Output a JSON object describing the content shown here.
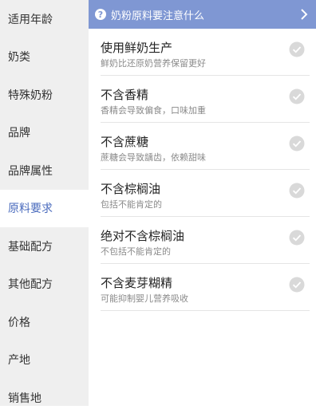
{
  "sidebar": {
    "items": [
      {
        "label": "适用年龄",
        "active": false
      },
      {
        "label": "奶类",
        "active": false
      },
      {
        "label": "特殊奶粉",
        "active": false
      },
      {
        "label": "品牌",
        "active": false
      },
      {
        "label": "品牌属性",
        "active": false
      },
      {
        "label": "原料要求",
        "active": true
      },
      {
        "label": "基础配方",
        "active": false
      },
      {
        "label": "其他配方",
        "active": false
      },
      {
        "label": "价格",
        "active": false
      },
      {
        "label": "产地",
        "active": false
      },
      {
        "label": "销售地",
        "active": false
      }
    ]
  },
  "banner": {
    "icon": "question-circle-icon",
    "title": "奶粉原料要注意什么",
    "chevron": "chevron-right-icon"
  },
  "options": [
    {
      "title": "使用鲜奶生产",
      "subtitle": "鲜奶比还原奶营养保留更好",
      "checked": false
    },
    {
      "title": "不含香精",
      "subtitle": "香精会导致偏食，口味加重",
      "checked": false
    },
    {
      "title": "不含蔗糖",
      "subtitle": "蔗糖会导致龋齿，依赖甜味",
      "checked": false
    },
    {
      "title": "不含棕榈油",
      "subtitle": "包括不能肯定的",
      "checked": false
    },
    {
      "title": "绝对不含棕榈油",
      "subtitle": "不包括不能肯定的",
      "checked": false
    },
    {
      "title": "不含麦芽糊精",
      "subtitle": "可能抑制婴儿营养吸收",
      "checked": false
    }
  ],
  "colors": {
    "accent": "#4a6bbd",
    "banner_bg": "#7f97d3",
    "sidebar_bg": "#efefef",
    "check_circle": "#d9d9d9"
  }
}
